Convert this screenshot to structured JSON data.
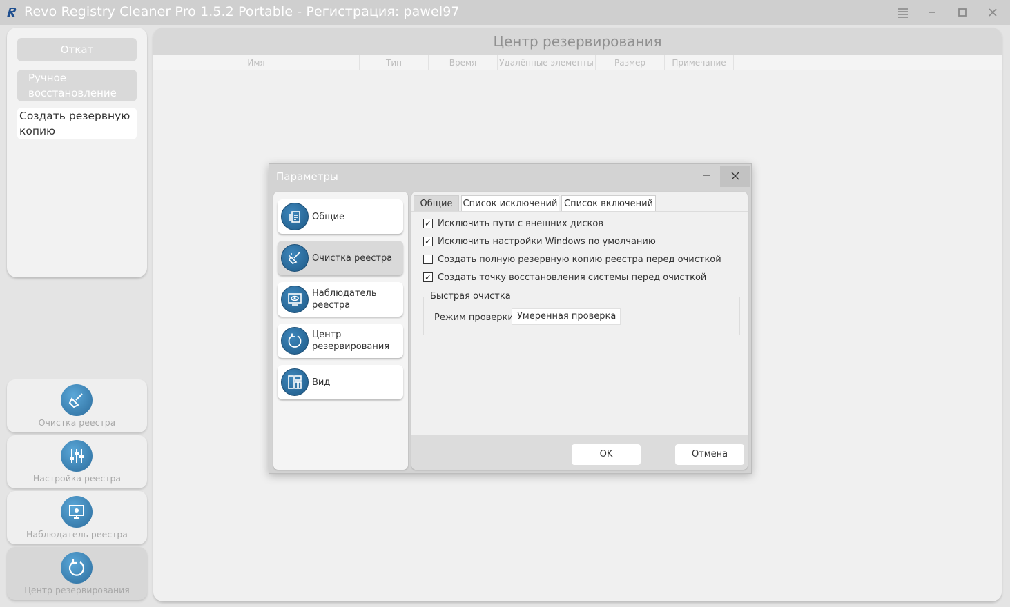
{
  "window": {
    "title": "Revo Registry Cleaner Pro 1.5.2 Portable - Регистрация: pawel97"
  },
  "left_panel": {
    "buttons": [
      {
        "label": "Откат"
      },
      {
        "label": "Ручное восстановление"
      },
      {
        "label": "Создать резервную копию"
      }
    ]
  },
  "nav": {
    "items": [
      {
        "label": "Очистка реестра",
        "icon": "broom-icon"
      },
      {
        "label": "Настройка реестра",
        "icon": "sliders-icon"
      },
      {
        "label": "Наблюдатель реестра",
        "icon": "monitor-icon"
      },
      {
        "label": "Центр резервирования",
        "icon": "backup-icon"
      }
    ]
  },
  "main": {
    "title": "Центр резервирования",
    "columns": [
      "Имя",
      "Тип",
      "Время",
      "Удалённые элементы",
      "Размер",
      "Примечание"
    ]
  },
  "dialog": {
    "title": "Параметры",
    "categories": [
      {
        "label": "Общие",
        "icon": "document-icon"
      },
      {
        "label": "Очистка реестра",
        "icon": "broom-icon"
      },
      {
        "label": "Наблюдатель реестра",
        "icon": "monitor-icon"
      },
      {
        "label": "Центр резервирования",
        "icon": "backup-icon"
      },
      {
        "label": "Вид",
        "icon": "layout-icon"
      }
    ],
    "tabs": [
      "Общие",
      "Список исключений",
      "Список включений"
    ],
    "options": [
      {
        "label": "Исключить пути с внешних дисков",
        "checked": true
      },
      {
        "label": "Исключить настройки Windows по умолчанию",
        "checked": true
      },
      {
        "label": "Создать полную резервную копию реестра перед очисткой",
        "checked": false
      },
      {
        "label": "Создать точку восстановления системы перед очисткой",
        "checked": true
      }
    ],
    "quick_clean": {
      "title": "Быстрая очистка",
      "mode_label": "Режим проверки:",
      "mode_value": "Умеренная проверка"
    },
    "ok_label": "OK",
    "cancel_label": "Отмена"
  }
}
